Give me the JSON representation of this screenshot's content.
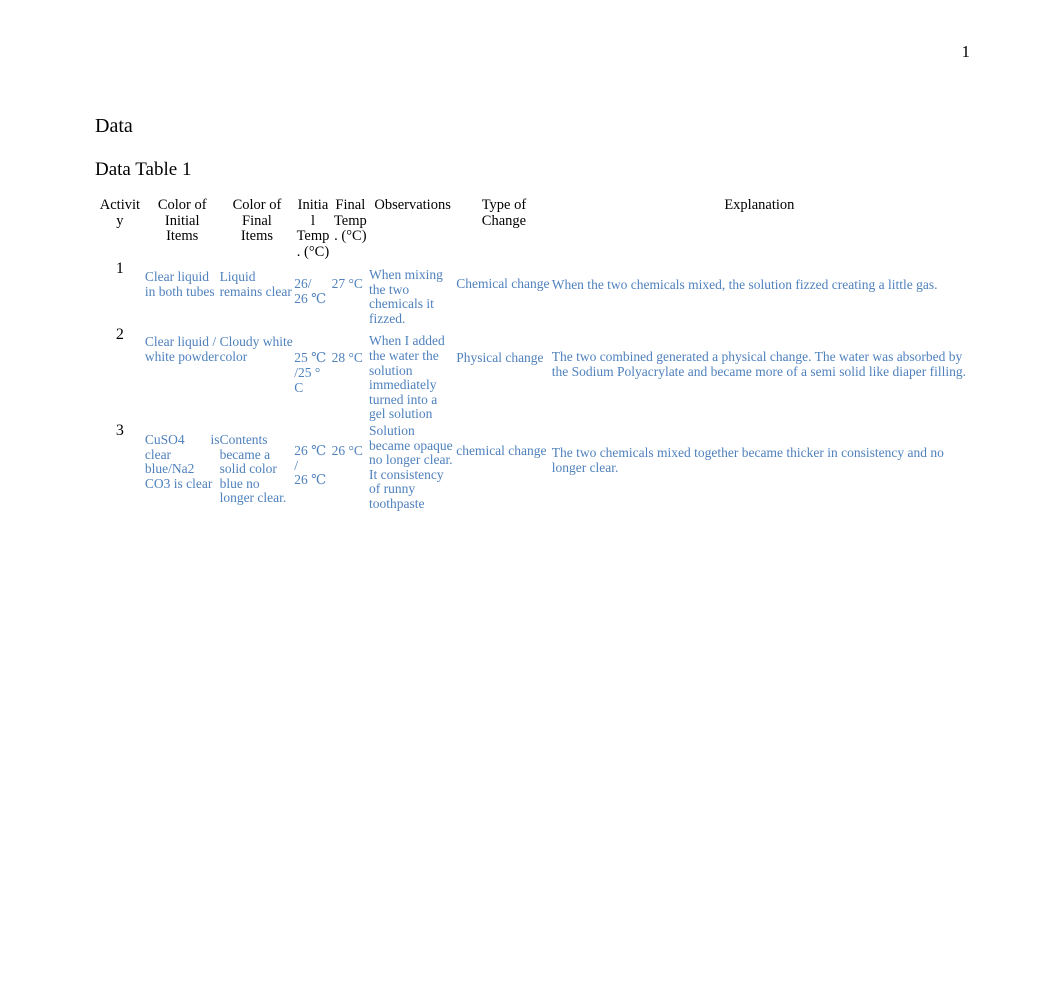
{
  "page": {
    "number": "1"
  },
  "headings": {
    "section": "Data",
    "table_title": "Data Table 1"
  },
  "colors": {
    "body_text": "#000000",
    "table_data_text": "#4f81bd",
    "background": "#ffffff"
  },
  "table": {
    "headers": {
      "activity": "Activit\ny",
      "color_initial": "Color of\nInitial\nItems",
      "color_final": "Color of\nFinal\nItems",
      "temp_initial": "Initia\nl\nTemp\n. (°C)",
      "temp_final": "Final\nTemp\n. (°C)",
      "observations": "Observations",
      "type_of_change": "Type of\nChange",
      "explanation": "Explanation"
    },
    "rows": [
      {
        "activity": "1",
        "color_initial": "Clear liquid in both tubes",
        "color_final": "Liquid remains clear",
        "temp_initial": "26/\n26 ℃",
        "temp_final": "27 °C",
        "observations": "When mixing the two chemicals it fizzed.",
        "type_of_change": "Chemical change",
        "explanation": "When the two chemicals mixed, the solution fizzed creating a little gas."
      },
      {
        "activity": "2",
        "color_initial": "Clear liquid / white powder",
        "color_final": "Cloudy white color",
        "temp_initial": "25 ℃\n/25 °\nC",
        "temp_final": "28 °C",
        "observations": "When I added the water the solution immediately turned into a gel solution",
        "type_of_change": "Physical change",
        "explanation": "The two combined generated a physical change. The water was absorbed by the Sodium Polyacrylate and became more of a semi solid like diaper filling."
      },
      {
        "activity": "3",
        "color_initial": "CuSO4 is clear blue/Na2 CO3   is clear",
        "color_final": "Contents became a solid color blue no longer clear.",
        "temp_initial": "26 ℃\n/\n26 ℃",
        "temp_final": "26 °C",
        "observations": "Solution became opaque no longer clear. It consistency of runny toothpaste",
        "type_of_change": "chemical change",
        "explanation": "The two chemicals mixed together became thicker in consistency and no longer clear."
      }
    ]
  }
}
